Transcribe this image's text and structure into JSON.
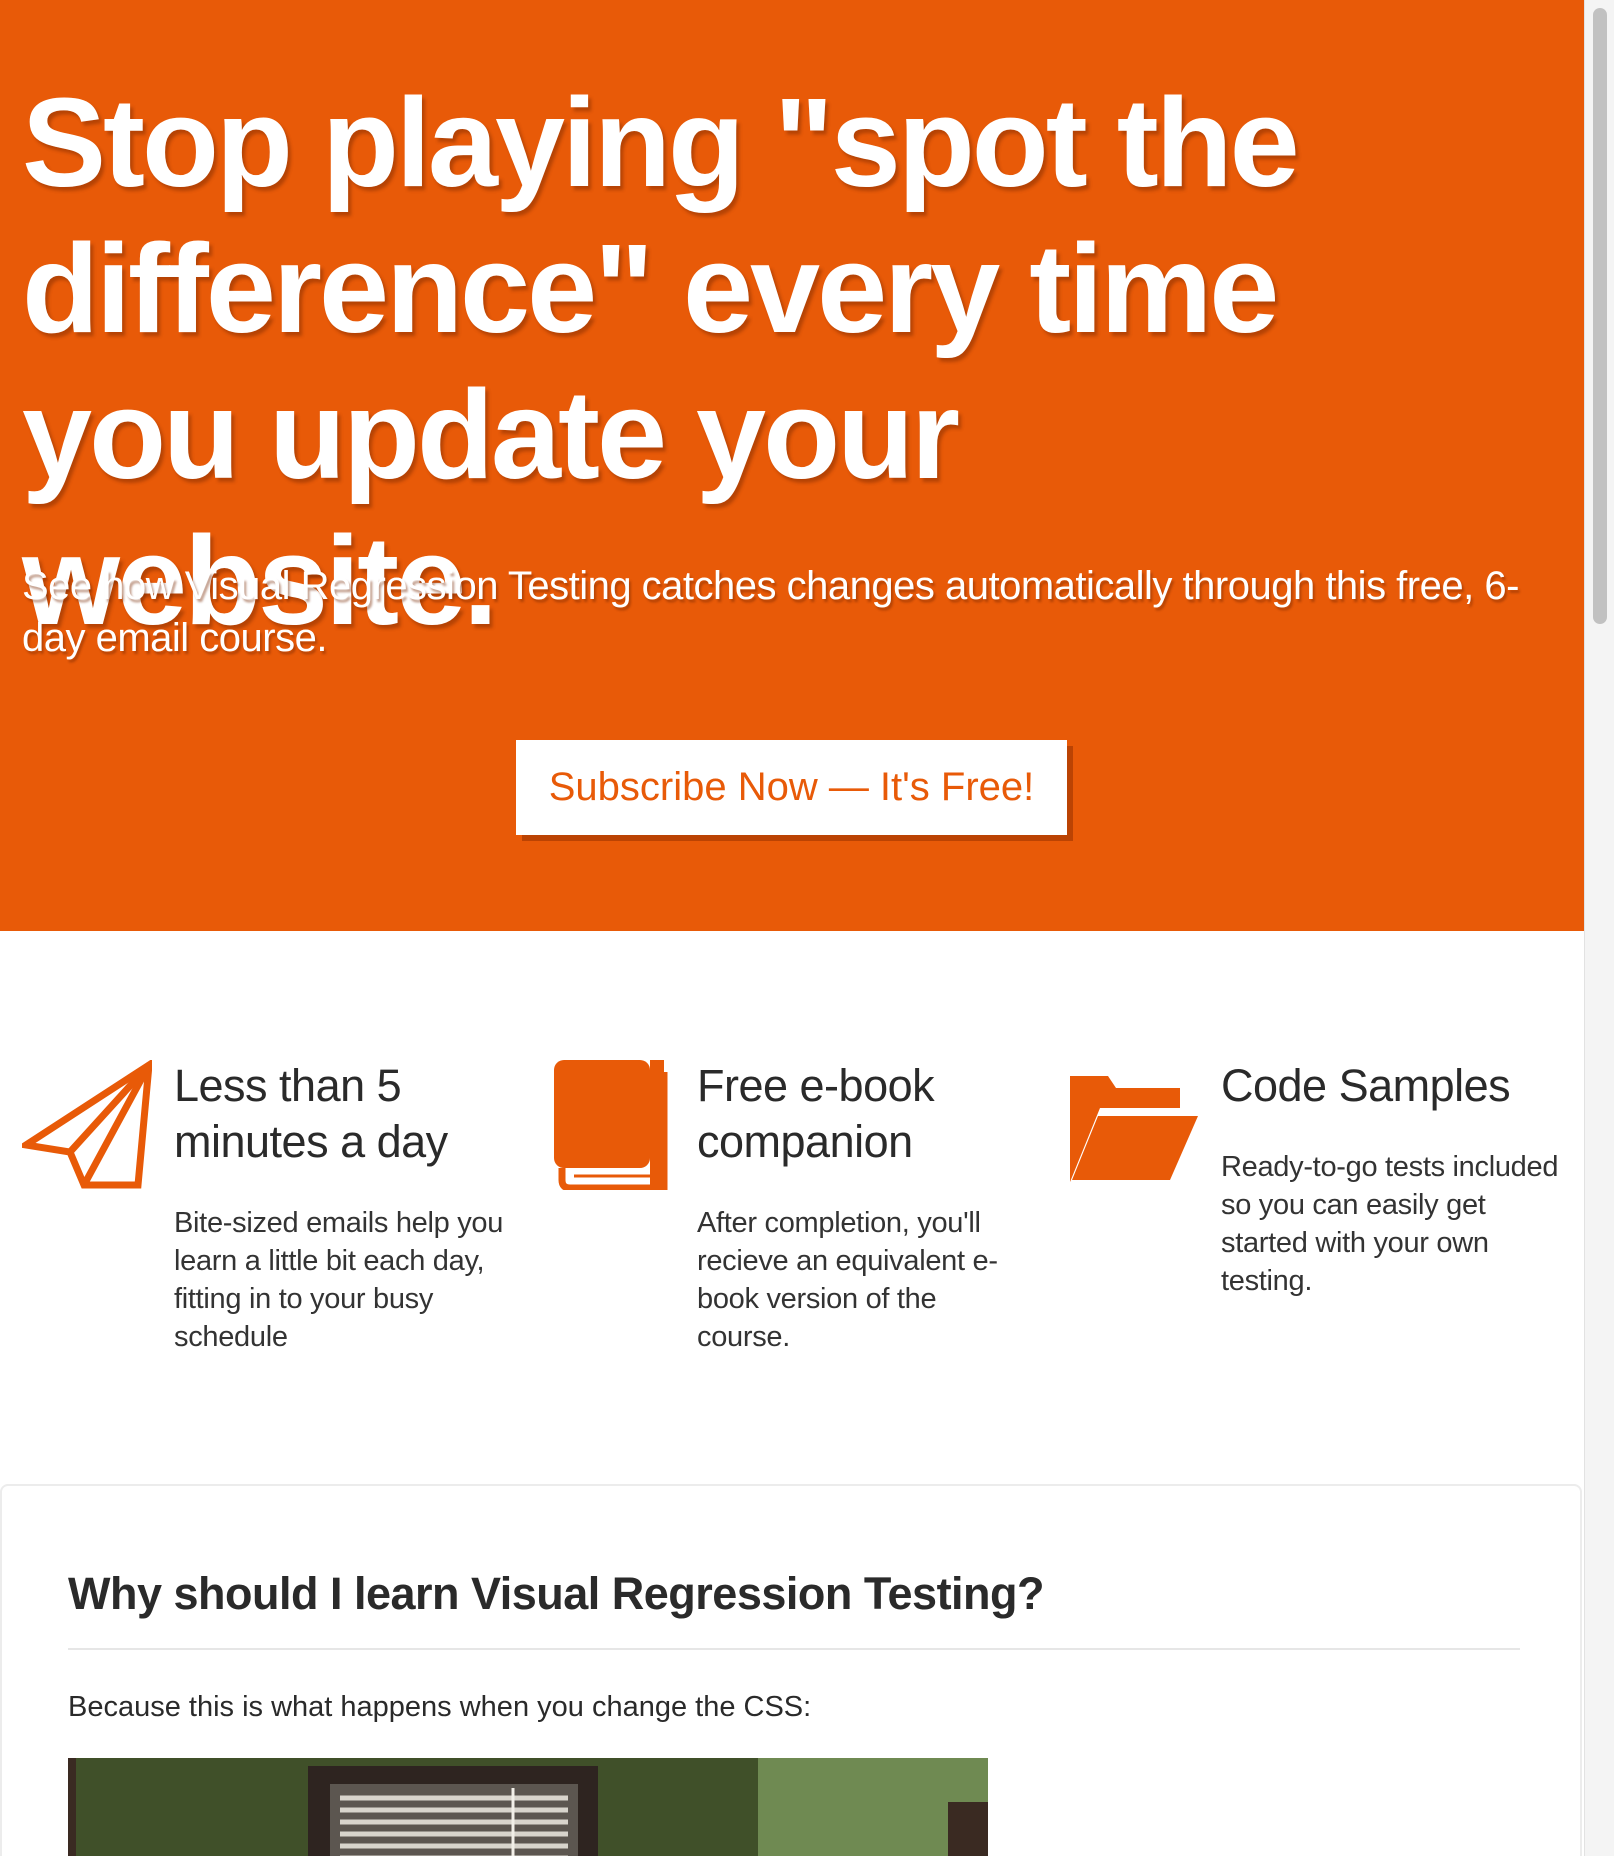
{
  "hero": {
    "title": "Stop playing \"spot the difference\" every time you update your website.",
    "subtitle": "See how Visual Regression Testing catches changes automatically through this free, 6-day email course.",
    "cta_label": "Subscribe Now — It's Free!",
    "background_color": "#e85a08"
  },
  "features": [
    {
      "icon": "paper-plane-icon",
      "title": "Less than 5 minutes a day",
      "description": "Bite-sized emails help you learn a little bit each day, fitting in to your busy schedule"
    },
    {
      "icon": "book-icon",
      "title": "Free e-book companion",
      "description": "After completion, you'll recieve an equivalent e-book version of the course."
    },
    {
      "icon": "folder-open-icon",
      "title": "Code Samples",
      "description": "Ready-to-go tests included so you can easily get started with your own testing."
    }
  ],
  "why_section": {
    "title": "Why should I learn Visual Regression Testing?",
    "text": "Because this is what happens when you change the CSS:"
  },
  "colors": {
    "accent": "#e85a08",
    "text_dark": "#2a2a2a"
  }
}
